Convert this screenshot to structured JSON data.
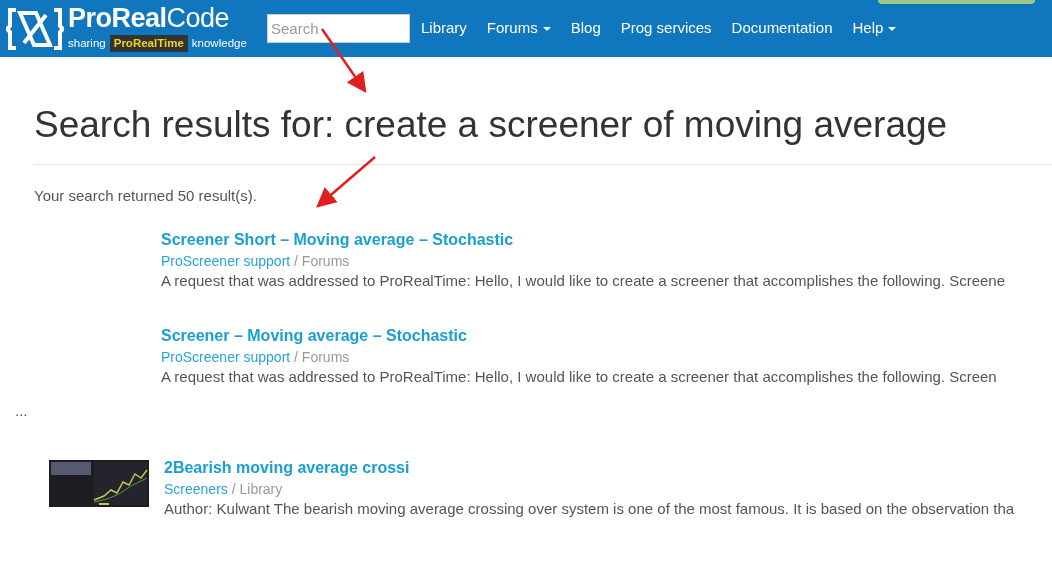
{
  "navbar": {
    "logo": {
      "brand_bold": "ProReal",
      "brand_light": "Code",
      "tagline_before": "sharing",
      "tagline_badge": "ProRealTime",
      "tagline_after": "knowledge"
    },
    "search": {
      "placeholder": "Search"
    },
    "menu": [
      {
        "label": "Library",
        "dropdown": false
      },
      {
        "label": "Forums",
        "dropdown": true
      },
      {
        "label": "Blog",
        "dropdown": false
      },
      {
        "label": "Prog services",
        "dropdown": false
      },
      {
        "label": "Documentation",
        "dropdown": false
      },
      {
        "label": "Help",
        "dropdown": true
      }
    ]
  },
  "heading": "Search results for: create a screener of moving average",
  "summary": "Your search returned 50 result(s).",
  "results": [
    {
      "kind": "text",
      "title": "Screener Short – Moving average – Stochastic",
      "category": "ProScreener support",
      "section": "/ Forums",
      "snippet": "A request that was addressed to ProRealTime: Hello, I would like to create a screener that accomplishes the following. Screene"
    },
    {
      "kind": "text",
      "title": "Screener – Moving average – Stochastic",
      "category": "ProScreener support",
      "section": "/ Forums",
      "snippet": "A request that was addressed to ProRealTime:  Hello, I would like to create a screener that accomplishes the following. Screen",
      "after": "..."
    },
    {
      "kind": "thumbnail",
      "title": "2Bearish moving average crossi",
      "category": "Screeners",
      "section": "/ Library",
      "snippet": "Author: Kulwant The bearish moving average crossing over system is one of the most famous. It is based on the observation tha"
    }
  ]
}
